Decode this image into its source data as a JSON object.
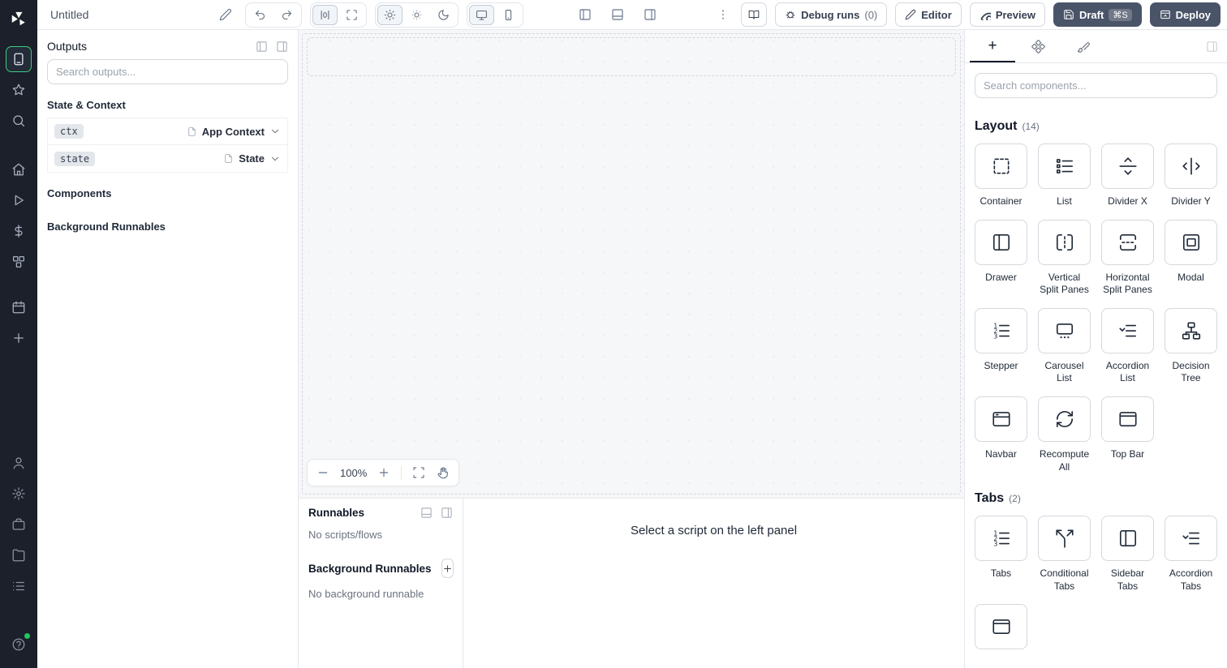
{
  "colors": {
    "accent_green": "#3ccb7f",
    "dark_button": "#4a5468",
    "sidebar_bg": "#1b202b"
  },
  "topbar": {
    "title": "Untitled",
    "debug_runs_label": "Debug runs",
    "debug_runs_count": "(0)",
    "editor_label": "Editor",
    "preview_label": "Preview",
    "draft_label": "Draft",
    "draft_shortcut": "⌘S",
    "deploy_label": "Deploy"
  },
  "canvas": {
    "zoom_level": "100%"
  },
  "outputs_panel": {
    "title": "Outputs",
    "search_placeholder": "Search outputs...",
    "state_context_header": "State & Context",
    "rows": [
      {
        "key": "ctx",
        "type": "App Context"
      },
      {
        "key": "state",
        "type": "State"
      }
    ],
    "components_header": "Components",
    "background_runnables_header": "Background Runnables"
  },
  "runnables_panel": {
    "title": "Runnables",
    "empty_scripts": "No scripts/flows",
    "background_title": "Background Runnables",
    "empty_background": "No background runnable",
    "hint": "Select a script on the left panel"
  },
  "components_panel": {
    "add_tab_label": "+",
    "search_placeholder": "Search components...",
    "sections": [
      {
        "title": "Layout",
        "count": "(14)",
        "items": [
          {
            "label": "Container",
            "icon": "container-icon"
          },
          {
            "label": "List",
            "icon": "list-icon"
          },
          {
            "label": "Divider X",
            "icon": "divider-x-icon"
          },
          {
            "label": "Divider Y",
            "icon": "divider-y-icon"
          },
          {
            "label": "Drawer",
            "icon": "drawer-icon"
          },
          {
            "label": "Vertical Split Panes",
            "icon": "vertical-split-panes-icon"
          },
          {
            "label": "Horizontal Split Panes",
            "icon": "horizontal-split-panes-icon"
          },
          {
            "label": "Modal",
            "icon": "modal-icon"
          },
          {
            "label": "Stepper",
            "icon": "stepper-icon"
          },
          {
            "label": "Carousel List",
            "icon": "carousel-list-icon"
          },
          {
            "label": "Accordion List",
            "icon": "accordion-list-icon"
          },
          {
            "label": "Decision Tree",
            "icon": "decision-tree-icon"
          },
          {
            "label": "Navbar",
            "icon": "navbar-icon"
          },
          {
            "label": "Recompute All",
            "icon": "recompute-all-icon"
          },
          {
            "label": "Top Bar",
            "icon": "top-bar-icon"
          }
        ]
      },
      {
        "title": "Tabs",
        "count": "(2)",
        "items": [
          {
            "label": "Tabs",
            "icon": "tabs-icon"
          },
          {
            "label": "Conditional Tabs",
            "icon": "conditional-tabs-icon"
          },
          {
            "label": "Sidebar Tabs",
            "icon": "sidebar-tabs-icon"
          },
          {
            "label": "Accordion Tabs",
            "icon": "accordion-tabs-icon"
          },
          {
            "label": "",
            "icon": "partial-card-icon"
          }
        ]
      }
    ]
  }
}
